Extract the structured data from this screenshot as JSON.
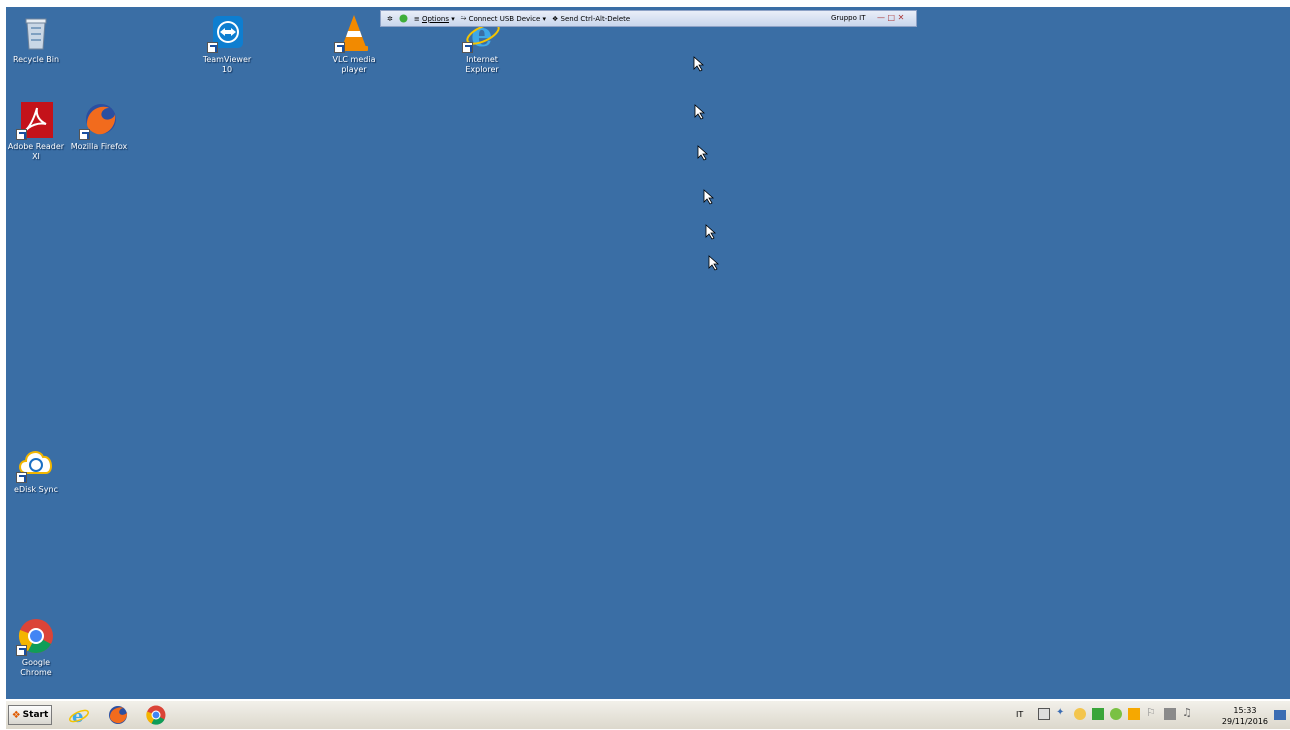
{
  "desktop": {
    "icons": [
      {
        "label": "Recycle Bin"
      },
      {
        "label": "TeamViewer\n10"
      },
      {
        "label": "VLC media\nplayer"
      },
      {
        "label": "Internet\nExplorer"
      },
      {
        "label": "Adobe Reader\nXI"
      },
      {
        "label": "Mozilla Firefox"
      },
      {
        "label": "eDisk Sync"
      },
      {
        "label": "Google\nChrome"
      }
    ]
  },
  "toolbar": {
    "options_label": "Options",
    "usb_label": "Connect USB Device",
    "cad_label": "Send Ctrl-Alt-Delete",
    "title": "Gruppo IT",
    "window_controls": "— □ ✕"
  },
  "taskbar": {
    "start_label": "Start",
    "language": "IT",
    "time": "15:33",
    "date": "29/11/2016"
  },
  "colors": {
    "desktop_bg": "#3a6ea5",
    "taskbar_bg": "#dcd8cc"
  }
}
